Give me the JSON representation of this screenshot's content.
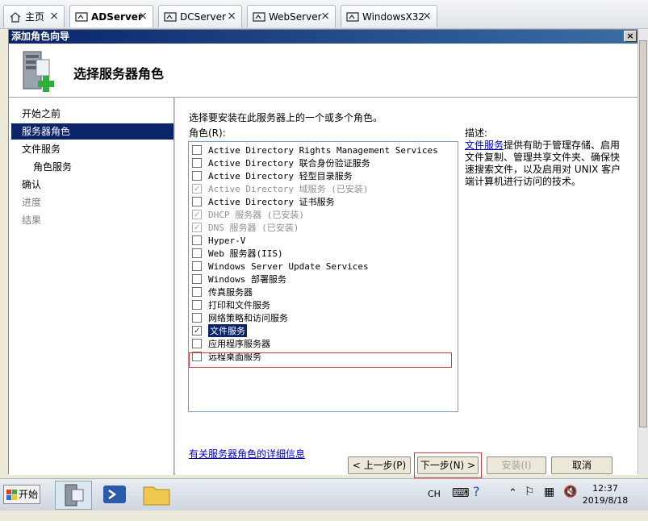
{
  "tabs": [
    {
      "label": "主页",
      "icon": "home-icon"
    },
    {
      "label": "ADServer",
      "icon": "vm-icon",
      "active": true
    },
    {
      "label": "DCServer",
      "icon": "vm-icon"
    },
    {
      "label": "WebServer",
      "icon": "vm-icon"
    },
    {
      "label": "WindowsX32",
      "icon": "vm-icon"
    }
  ],
  "window": {
    "title": "添加角色向导",
    "close_label": "×"
  },
  "header": {
    "title": "选择服务器角色"
  },
  "nav": [
    "开始之前",
    "服务器角色",
    "文件服务",
    "角色服务",
    "确认",
    "进度",
    "结果"
  ],
  "content": {
    "instruction": "选择要安装在此服务器上的一个或多个角色。",
    "roles_label": "角色(R):",
    "desc_label": "描述:",
    "desc_link": "文件服务",
    "desc_text": "提供有助于管理存储、启用文件复制、管理共享文件夹、确保快速搜索文件，以及启用对 UNIX 客户端计算机进行访问的技术。",
    "more_link": "有关服务器角色的详细信息"
  },
  "roles": [
    {
      "label": "Active Directory Rights Management Services",
      "checked": false,
      "disabled": false
    },
    {
      "label": "Active Directory 联合身份验证服务",
      "checked": false,
      "disabled": false
    },
    {
      "label": "Active Directory 轻型目录服务",
      "checked": false,
      "disabled": false
    },
    {
      "label": "Active Directory 域服务  (已安装)",
      "checked": true,
      "disabled": true
    },
    {
      "label": "Active Directory 证书服务",
      "checked": false,
      "disabled": false
    },
    {
      "label": "DHCP 服务器  (已安装)",
      "checked": true,
      "disabled": true
    },
    {
      "label": "DNS 服务器  (已安装)",
      "checked": true,
      "disabled": true
    },
    {
      "label": "Hyper-V",
      "checked": false,
      "disabled": false
    },
    {
      "label": "Web 服务器(IIS)",
      "checked": false,
      "disabled": false
    },
    {
      "label": "Windows Server Update Services",
      "checked": false,
      "disabled": false
    },
    {
      "label": "Windows 部署服务",
      "checked": false,
      "disabled": false
    },
    {
      "label": "传真服务器",
      "checked": false,
      "disabled": false
    },
    {
      "label": "打印和文件服务",
      "checked": false,
      "disabled": false
    },
    {
      "label": "网络策略和访问服务",
      "checked": false,
      "disabled": false
    },
    {
      "label": "文件服务",
      "checked": true,
      "disabled": false,
      "selected": true
    },
    {
      "label": "应用程序服务器",
      "checked": false,
      "disabled": false
    },
    {
      "label": "远程桌面服务",
      "checked": false,
      "disabled": false
    }
  ],
  "buttons": {
    "back": "< 上一步(P)",
    "next": "下一步(N) >",
    "install": "安装(I)",
    "cancel": "取消"
  },
  "taskbar": {
    "start": "开始",
    "lang": "CH",
    "time": "12:37",
    "date": "2019/8/18"
  }
}
